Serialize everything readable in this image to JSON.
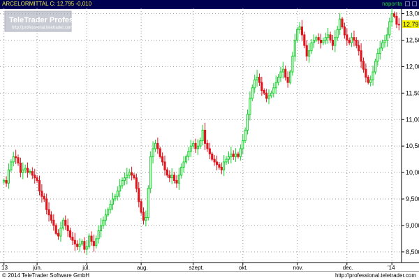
{
  "header": {
    "symbol_line": "ARCELORMITTAL C: 12,795 -0,010",
    "period": "naponta"
  },
  "watermark": {
    "title": "TeleTrader Professional",
    "url": "http://professional.teletrader.com"
  },
  "footer": {
    "copyright": "© 2014 TeleTrader Software GmbH",
    "url": "http://professional.teletrader.com"
  },
  "colors": {
    "up": "#12d128",
    "down": "#e0141c",
    "background": "#ffffff",
    "header_bg": "#000050",
    "last_price_label": "#f2f200"
  },
  "chart_data": {
    "type": "candlestick",
    "ylim": [
      8.3,
      13.1
    ],
    "yticks": [
      "13,000",
      "12,500",
      "12,000",
      "11,500",
      "11,000",
      "10,500",
      "10,000",
      "9,500",
      "9,000",
      "8,500"
    ],
    "ytick_values": [
      13.0,
      12.5,
      12.0,
      11.5,
      11.0,
      10.5,
      10.0,
      9.5,
      9.0,
      8.5
    ],
    "xticks": [
      {
        "label": "13",
        "index": 0
      },
      {
        "label": "jún.",
        "index": 14
      },
      {
        "label": "júl.",
        "index": 35
      },
      {
        "label": "aug.",
        "index": 58
      },
      {
        "label": "szept.",
        "index": 80
      },
      {
        "label": "okt.",
        "index": 101
      },
      {
        "label": "nov.",
        "index": 124
      },
      {
        "label": "dec.",
        "index": 145
      },
      {
        "label": "'14",
        "index": 164
      }
    ],
    "last_price": 12.795,
    "last_price_label": "12,795",
    "grid": true,
    "close_series": [
      9.85,
      9.8,
      10.05,
      10.2,
      10.3,
      10.28,
      10.18,
      10.0,
      10.05,
      10.08,
      10.0,
      10.02,
      9.95,
      9.9,
      9.85,
      9.65,
      9.55,
      9.5,
      9.3,
      9.2,
      9.1,
      9.0,
      8.85,
      8.8,
      8.95,
      9.1,
      9.0,
      8.9,
      8.78,
      8.72,
      8.65,
      8.6,
      8.65,
      8.7,
      8.55,
      8.6,
      8.8,
      8.7,
      8.62,
      8.75,
      8.9,
      9.0,
      9.1,
      9.2,
      9.3,
      9.4,
      9.5,
      9.55,
      9.65,
      9.75,
      9.85,
      9.9,
      9.95,
      10.0,
      9.95,
      9.9,
      9.7,
      9.45,
      9.25,
      9.1,
      9.15,
      9.7,
      10.3,
      10.45,
      10.55,
      10.45,
      10.3,
      10.2,
      10.05,
      9.95,
      9.9,
      9.95,
      9.85,
      9.8,
      9.95,
      10.1,
      10.2,
      10.3,
      10.4,
      10.5,
      10.55,
      10.45,
      10.5,
      10.6,
      10.8,
      10.55,
      10.45,
      10.35,
      10.25,
      10.2,
      10.15,
      10.1,
      10.05,
      10.2,
      10.25,
      10.3,
      10.35,
      10.3,
      10.35,
      10.3,
      10.45,
      10.6,
      10.8,
      11.1,
      11.4,
      11.6,
      11.75,
      11.8,
      11.7,
      11.55,
      11.5,
      11.4,
      11.45,
      11.5,
      11.6,
      11.7,
      11.8,
      11.9,
      11.95,
      11.8,
      11.7,
      11.9,
      12.2,
      12.5,
      12.7,
      12.75,
      12.6,
      12.4,
      12.2,
      12.3,
      12.45,
      12.5,
      12.55,
      12.5,
      12.45,
      12.5,
      12.55,
      12.6,
      12.5,
      12.4,
      12.55,
      12.7,
      12.9,
      12.75,
      12.6,
      12.5,
      12.45,
      12.55,
      12.5,
      12.4,
      12.3,
      12.1,
      11.95,
      11.8,
      11.7,
      11.75,
      11.9,
      12.1,
      12.25,
      12.35,
      12.45,
      12.5,
      12.6,
      12.85,
      13.0,
      12.95,
      12.8,
      12.795
    ]
  }
}
